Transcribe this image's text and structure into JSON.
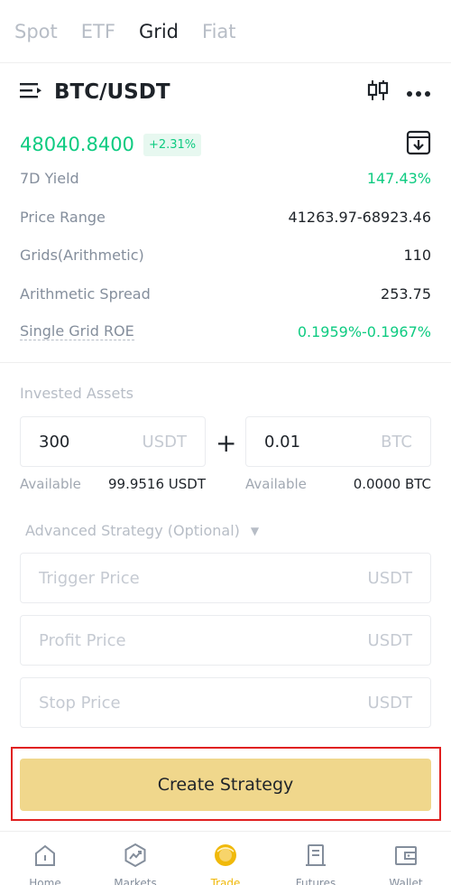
{
  "tabs": [
    {
      "label": "Spot",
      "active": false
    },
    {
      "label": "ETF",
      "active": false
    },
    {
      "label": "Grid",
      "active": true
    },
    {
      "label": "Fiat",
      "active": false
    }
  ],
  "pair": {
    "name": "BTC/USDT",
    "menu_icon": "list-menu-icon",
    "chart_icon": "candlestick-icon",
    "more_icon": "more-dots-icon"
  },
  "price": {
    "value": "48040.8400",
    "change": "+2.31%",
    "download_icon": "download-icon"
  },
  "stats": [
    {
      "label": "7D Yield",
      "value": "147.43%"
    },
    {
      "label": "Price Range",
      "value": "41263.97-68923.46"
    },
    {
      "label": "Grids(Arithmetic)",
      "value": "110"
    },
    {
      "label": "Arithmetic Spread",
      "value": "253.75"
    },
    {
      "label": "Single Grid ROE",
      "value": "0.1959%-0.1967%"
    }
  ],
  "invested": {
    "label": "Invested Assets",
    "usdt": {
      "value": "300",
      "unit": "USDT"
    },
    "btc": {
      "value": "0.01",
      "unit": "BTC"
    },
    "plus": "+",
    "available_label": "Available",
    "usdt_available": "99.9516 USDT",
    "btc_available": "0.0000 BTC"
  },
  "advanced": {
    "label": "Advanced Strategy (Optional)",
    "caret": "▼",
    "trigger": {
      "placeholder": "Trigger Price",
      "unit": "USDT"
    },
    "profit": {
      "placeholder": "Profit Price",
      "unit": "USDT"
    },
    "stop": {
      "placeholder": "Stop Price",
      "unit": "USDT"
    }
  },
  "create_button": "Create Strategy",
  "colors": {
    "green": "#0ecb81",
    "yellow_button": "#f0d78c",
    "accent": "#f0b90b",
    "highlight": "#e02020"
  },
  "nav": [
    {
      "label": "Home",
      "icon": "home-icon",
      "active": false
    },
    {
      "label": "Markets",
      "icon": "markets-icon",
      "active": false
    },
    {
      "label": "Trade",
      "icon": "trade-icon",
      "active": true
    },
    {
      "label": "Futures",
      "icon": "futures-icon",
      "active": false
    },
    {
      "label": "Wallet",
      "icon": "wallet-icon",
      "active": false
    }
  ]
}
